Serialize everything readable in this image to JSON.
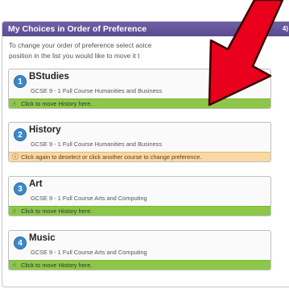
{
  "panel": {
    "title": "My Choices in Order of Preference",
    "count": "4)",
    "instructions_line1": "To change your order of preference select a",
    "instructions_line1b": "oice",
    "instructions_line2": "position in the list you would like to move it t"
  },
  "choices": [
    {
      "number": "1",
      "title": "BStudies",
      "subtitle": "GCSE 9 - 1 Full Course Humanities and Business",
      "action": "Click to move History here.",
      "state": "move"
    },
    {
      "number": "2",
      "title": "History",
      "subtitle": "GCSE 9 - 1 Full Course Humanities and Business",
      "action": "Click again to deselect or click another course to change preference.",
      "state": "selected"
    },
    {
      "number": "3",
      "title": "Art",
      "subtitle": "GCSE 9 - 1 Full Course Arts and Computing",
      "action": "Click to move History here.",
      "state": "move"
    },
    {
      "number": "4",
      "title": "Music",
      "subtitle": "GCSE 9 - 1 Full Course Arts and Computing",
      "action": "Click to move History here.",
      "state": "move"
    }
  ],
  "icons": {
    "move": "hand-pointer-icon",
    "selected": "info-icon"
  },
  "colors": {
    "header": "#5b4b92",
    "badge": "#3c88c9",
    "move_bar": "#8dc74a",
    "selected_bar": "#f9d8a3",
    "arrow": "#e8001c"
  }
}
